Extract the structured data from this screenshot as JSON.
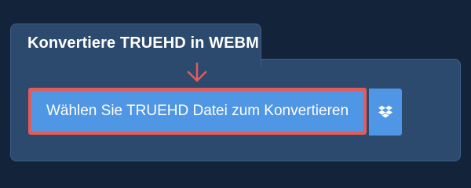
{
  "tab": {
    "title": "Konvertiere TRUEHD in WEBM"
  },
  "convert_button": {
    "label": "Wählen Sie TRUEHD Datei zum Konvertieren"
  },
  "dropbox_button": {
    "icon": "dropbox-icon"
  },
  "colors": {
    "background": "#12233a",
    "panel": "#2c4a6d",
    "button": "#4f96e4",
    "highlight": "#e45b5b"
  }
}
